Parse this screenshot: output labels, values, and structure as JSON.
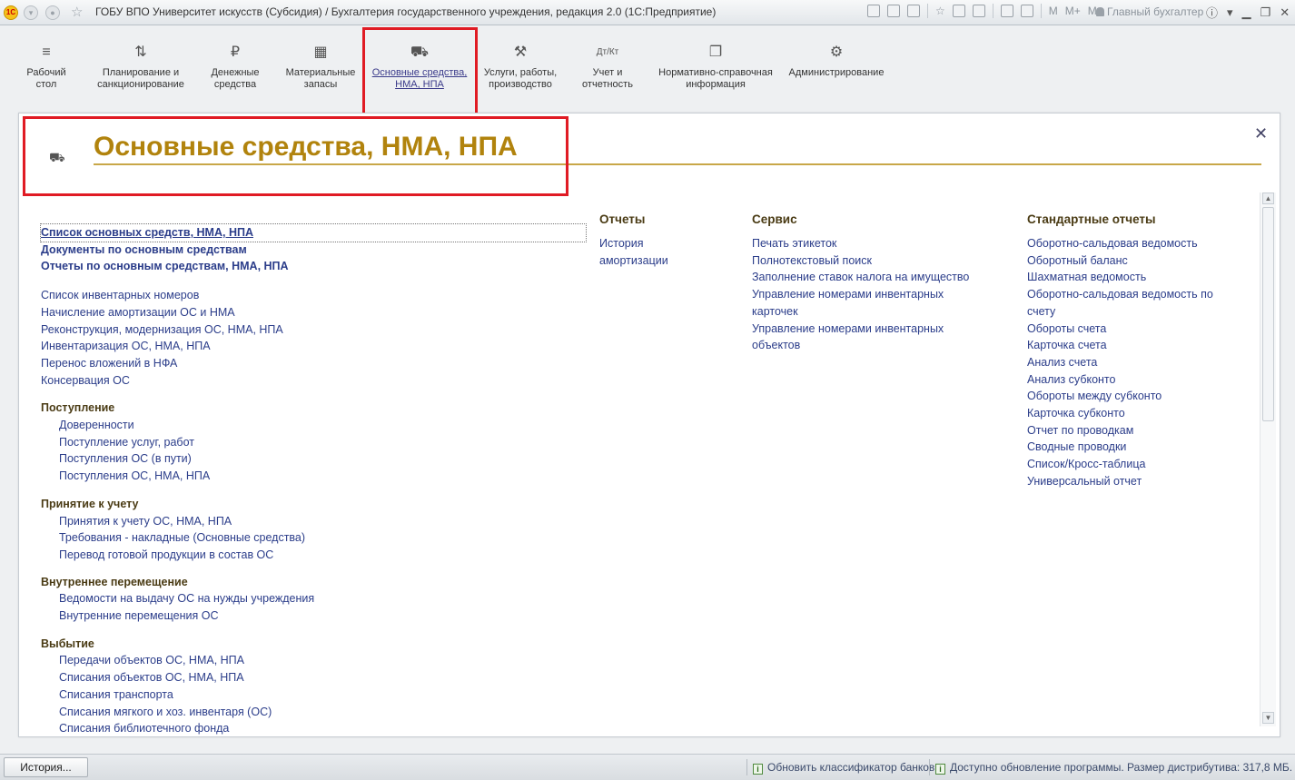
{
  "window": {
    "title": "ГОБУ ВПО Университет искусств (Субсидия) / Бухгалтерия государственного учреждения, редакция 2.0  (1С:Предприятие)",
    "user": "Главный бухгалтер",
    "memory_buttons": [
      "M",
      "M+",
      "M-"
    ]
  },
  "sections": [
    {
      "label": "Рабочий\nстол",
      "icon": "menu-icon"
    },
    {
      "label": "Планирование и\nсанкционирование",
      "icon": "planning-icon"
    },
    {
      "label": "Денежные\nсредства",
      "icon": "ruble-icon"
    },
    {
      "label": "Материальные\nзапасы",
      "icon": "grid-icon"
    },
    {
      "label": "Основные средства,\nНМА, НПА",
      "icon": "truck-icon",
      "active": true
    },
    {
      "label": "Услуги, работы,\nпроизводство",
      "icon": "tools-icon"
    },
    {
      "label": "Учет и\nотчетность",
      "icon": "dt-kt-icon"
    },
    {
      "label": "Нормативно-справочная\nинформация",
      "icon": "books-icon"
    },
    {
      "label": "Администрирование",
      "icon": "gear-icon"
    }
  ],
  "page": {
    "title": "Основные средства, НМА, НПА"
  },
  "main_column": {
    "primary": [
      "Список основных средств, НМА, НПА",
      "Документы по основным средствам",
      "Отчеты по основным средствам, НМА, НПА"
    ],
    "links": [
      "Список инвентарных номеров",
      "Начисление амортизации ОС и НМА",
      "Реконструкция, модернизация ОС, НМА, НПА",
      "Инвентаризация ОС, НМА, НПА",
      "Перенос вложений в НФА",
      "Консервация ОС"
    ],
    "groups": [
      {
        "title": "Поступление",
        "items": [
          "Доверенности",
          "Поступление услуг, работ",
          "Поступления ОС (в пути)",
          "Поступления ОС, НМА, НПА"
        ]
      },
      {
        "title": "Принятие к учету",
        "items": [
          "Принятия к учету ОС, НМА, НПА",
          "Требования - накладные (Основные средства)",
          "Перевод готовой продукции в состав ОС"
        ]
      },
      {
        "title": "Внутреннее перемещение",
        "items": [
          "Ведомости на выдачу ОС на нужды учреждения",
          "Внутренние перемещения ОС"
        ]
      },
      {
        "title": "Выбытие",
        "items": [
          "Передачи объектов ОС, НМА, НПА",
          "Списания объектов ОС, НМА, НПА",
          "Списания транспорта",
          "Списания мягкого и хоз. инвентаря (ОС)",
          "Списания библиотечного фонда"
        ]
      }
    ]
  },
  "reports": {
    "title": "Отчеты",
    "items": [
      "История амортизации"
    ]
  },
  "service": {
    "title": "Сервис",
    "items": [
      "Печать этикеток",
      "Полнотекстовый поиск",
      "Заполнение ставок налога на имущество",
      "Управление номерами инвентарных карточек",
      "Управление номерами инвентарных объектов"
    ]
  },
  "standard_reports": {
    "title": "Стандартные отчеты",
    "items": [
      "Оборотно-сальдовая ведомость",
      "Оборотный баланс",
      "Шахматная ведомость",
      "Оборотно-сальдовая ведомость по счету",
      "Обороты счета",
      "Карточка счета",
      "Анализ счета",
      "Анализ субконто",
      "Обороты между субконто",
      "Карточка субконто",
      "Отчет по проводкам",
      "Сводные проводки",
      "Список/Кросс-таблица",
      "Универсальный отчет"
    ]
  },
  "statusbar": {
    "history_button": "История...",
    "messages": [
      "Обновить классификатор банков",
      "Доступно обновление программы. Размер дистрибутива: 317,8 МБ."
    ]
  },
  "colors": {
    "title_gold": "#b1830d",
    "link_blue": "#2b3d8a",
    "group_brown": "#4a3b14",
    "highlight_red": "#e01b24"
  }
}
